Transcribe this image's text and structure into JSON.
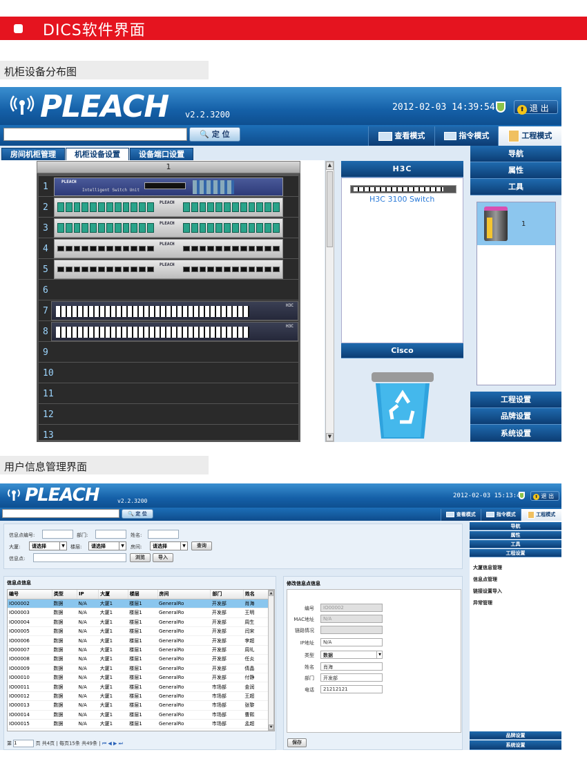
{
  "banner": {
    "title": "DICS软件界面"
  },
  "section1": {
    "title": "机柜设备分布图"
  },
  "section2": {
    "title": "用户信息管理界面"
  },
  "app1": {
    "logo": "PLEACH",
    "version": "v2.2.3200",
    "datetime": "2012-02-03 14:39:54",
    "exit_label": "退 出",
    "search_placeholder": "",
    "locate_label": "定 位",
    "modes": [
      "查看模式",
      "指令模式",
      "工程模式"
    ],
    "tabs": [
      "房间机柜管理",
      "机柜设备设置",
      "设备端口设置"
    ],
    "rack": {
      "title": "1",
      "slots": [
        "1",
        "2",
        "3",
        "4",
        "5",
        "6",
        "7",
        "8",
        "9",
        "10",
        "11",
        "12",
        "13"
      ],
      "device_brand": "PLEACH",
      "switch_unit_label": "Intelligent Switch Unit",
      "switch_brand": "H3C"
    },
    "catalog": {
      "group1": "H3C",
      "item1": "H3C 3100 Switch",
      "group2": "Cisco"
    },
    "right_nav": [
      "导航",
      "属性",
      "工具"
    ],
    "cabinet_item": "1",
    "right_bottom": [
      "工程设置",
      "品牌设置",
      "系统设置"
    ]
  },
  "app2": {
    "logo": "PLEACH",
    "version": "v2.2.3200",
    "datetime": "2012-02-03 15:13:48",
    "exit_label": "退 出",
    "locate_label": "定 位",
    "modes": [
      "查看模式",
      "指令模式",
      "工程模式"
    ],
    "filter": {
      "info_id_label": "信息点编号:",
      "dept_label": "部门:",
      "name_label": "姓名:",
      "building_label": "大厦:",
      "floor_label": "楼层:",
      "room_label": "房间:",
      "select_placeholder": "请选择",
      "query_label": "查询",
      "info_point_label": "信息点:",
      "browse_label": "浏览",
      "import_label": "导入"
    },
    "list_title": "信息点信息",
    "columns": [
      "编号",
      "类型",
      "IP",
      "大厦",
      "楼层",
      "房间",
      "部门",
      "姓名"
    ],
    "rows": [
      [
        "IO00002",
        "数据",
        "N/A",
        "大厦1",
        "楼层1",
        "GeneralRo",
        "开发部",
        "肖海"
      ],
      [
        "IO00003",
        "数据",
        "N/A",
        "大厦1",
        "楼层1",
        "GeneralRo",
        "开发部",
        "王明"
      ],
      [
        "IO00004",
        "数据",
        "N/A",
        "大厦1",
        "楼层1",
        "GeneralRo",
        "开发部",
        "周生"
      ],
      [
        "IO00005",
        "数据",
        "N/A",
        "大厦1",
        "楼层1",
        "GeneralRo",
        "开发部",
        "闫宋"
      ],
      [
        "IO00006",
        "数据",
        "N/A",
        "大厦1",
        "楼层1",
        "GeneralRo",
        "开发部",
        "李超"
      ],
      [
        "IO00007",
        "数据",
        "N/A",
        "大厦1",
        "楼层1",
        "GeneralRo",
        "开发部",
        "周礼"
      ],
      [
        "IO00008",
        "数据",
        "N/A",
        "大厦1",
        "楼层1",
        "GeneralRo",
        "开发部",
        "任炎"
      ],
      [
        "IO00009",
        "数据",
        "N/A",
        "大厦1",
        "楼层1",
        "GeneralRo",
        "开发部",
        "倩晶"
      ],
      [
        "IO00010",
        "数据",
        "N/A",
        "大厦1",
        "楼层1",
        "GeneralRo",
        "开发部",
        "付静"
      ],
      [
        "IO00011",
        "数据",
        "N/A",
        "大厦1",
        "楼层1",
        "GeneralRo",
        "市场部",
        "金润"
      ],
      [
        "IO00012",
        "数据",
        "N/A",
        "大厦1",
        "楼层1",
        "GeneralRo",
        "市场部",
        "王超"
      ],
      [
        "IO00013",
        "数据",
        "N/A",
        "大厦1",
        "楼层1",
        "GeneralRo",
        "市场部",
        "张黎"
      ],
      [
        "IO00014",
        "数据",
        "N/A",
        "大厦1",
        "楼层1",
        "GeneralRo",
        "市场部",
        "曹熙"
      ],
      [
        "IO00015",
        "数据",
        "N/A",
        "大厦1",
        "楼层1",
        "GeneralRo",
        "市场部",
        "孟超"
      ]
    ],
    "pager": {
      "page_prefix": "第",
      "page_value": "1",
      "page_suffix": "页",
      "summary": "共4页 | 每页15条  共49条  |"
    },
    "edit_title": "修改信息点信息",
    "edit_fields": [
      {
        "label": "编号",
        "value": "IO00002"
      },
      {
        "label": "MAC地址",
        "value": "N/A"
      },
      {
        "label": "链路情况",
        "value": ""
      },
      {
        "label": "IP地址",
        "value": "N/A"
      },
      {
        "label": "类型",
        "value": "数据"
      },
      {
        "label": "姓名",
        "value": "肖海"
      },
      {
        "label": "部门",
        "value": "开发部"
      },
      {
        "label": "电话",
        "value": "21212121"
      }
    ],
    "save_label": "保存",
    "right_nav": [
      "导航",
      "属性",
      "工具",
      "工程设置"
    ],
    "settings_items": [
      "大厦信息管理",
      "信息点管理",
      "链接设置导入",
      "异常管理"
    ],
    "right_bottom": [
      "品牌设置",
      "系统设置"
    ]
  }
}
